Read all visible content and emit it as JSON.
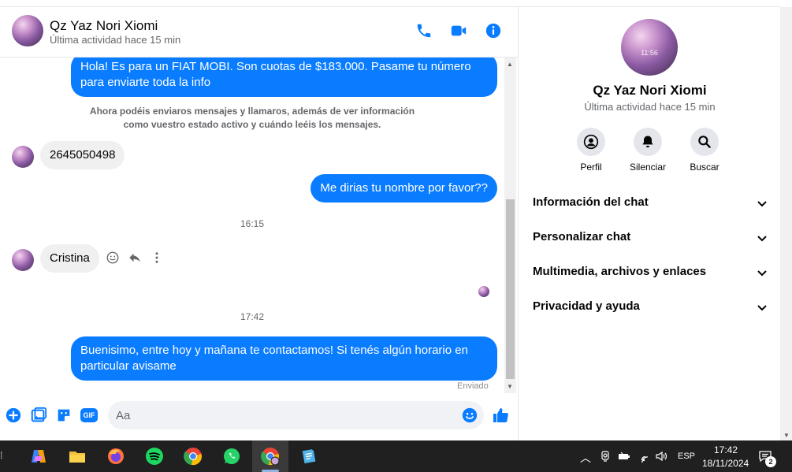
{
  "contact": {
    "name": "Qz Yaz Nori Xiomi",
    "status": "Última actividad hace 15 min",
    "avatar_time": "11:56"
  },
  "messages": {
    "m1_out": "Hola! Es para un FIAT MOBI. Son cuotas de $183.000. Pasame tu número para enviarte toda la info",
    "system": "Ahora podéis enviaros mensajes y llamaros, además de ver información como vuestro estado activo y cuándo leéis los mensajes.",
    "m2_in": "2645050498",
    "m3_out": "Me dirias tu nombre por favor??",
    "time1": "16:15",
    "m4_in": "Cristina",
    "time2": "17:42",
    "m5_out": "Buenisimo, entre hoy y mañana te contactamos! Si tenés algún horario en particular avisame",
    "sent_status": "Enviado"
  },
  "composer": {
    "placeholder": "Aa",
    "gif_label": "GIF"
  },
  "info_panel": {
    "actions": [
      "Perfil",
      "Silenciar",
      "Buscar"
    ],
    "sections": [
      "Información del chat",
      "Personalizar chat",
      "Multimedia, archivos y enlaces",
      "Privacidad y ayuda"
    ]
  },
  "taskbar": {
    "language": "ESP",
    "time": "17:42",
    "date": "18/11/2024",
    "notification_count": "2"
  },
  "colors": {
    "accent": "#0a7cff",
    "bubble_in": "#f0f0f0",
    "taskbar": "#202020"
  }
}
